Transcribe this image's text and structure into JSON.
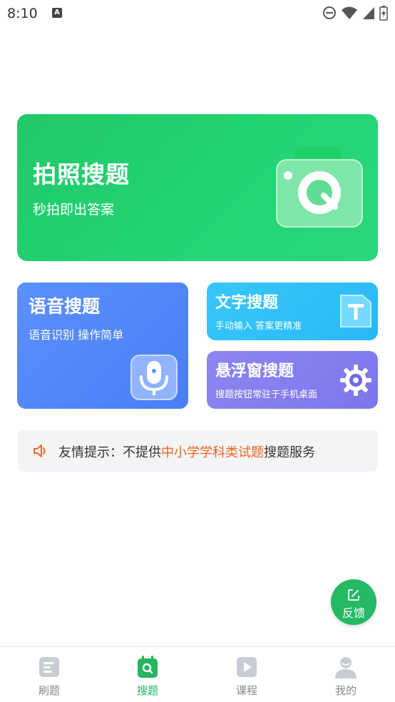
{
  "status_bar": {
    "time": "8:10",
    "notification_icon": "A"
  },
  "photo_search": {
    "title": "拍照搜题",
    "subtitle": "秒拍即出答案",
    "icon": "camera-icon"
  },
  "voice_search": {
    "title": "语音搜题",
    "subtitle": "语音识别 操作简单",
    "icon": "microphone-icon"
  },
  "text_search": {
    "title": "文字搜题",
    "subtitle": "手动输入 答案更精准",
    "icon": "text-t-icon"
  },
  "float_search": {
    "title": "悬浮窗搜题",
    "subtitle": "搜题按钮常驻于手机桌面",
    "icon": "gear-icon"
  },
  "notice": {
    "prefix": "友情提示：不提供",
    "highlight": "中小学学科类试题",
    "suffix": "搜题服务"
  },
  "feedback": {
    "label": "反馈"
  },
  "bottom_nav": [
    {
      "label": "刷题",
      "icon": "document-icon",
      "active": false
    },
    {
      "label": "搜题",
      "icon": "search-calendar-icon",
      "active": true
    },
    {
      "label": "课程",
      "icon": "play-icon",
      "active": false
    },
    {
      "label": "我的",
      "icon": "user-icon",
      "active": false
    }
  ],
  "colors": {
    "primary_green": "#23d574",
    "voice_blue": "#4a7ef5",
    "text_cyan": "#2ab8f5",
    "float_purple": "#7b76ec",
    "highlight_orange": "#f0641e"
  }
}
